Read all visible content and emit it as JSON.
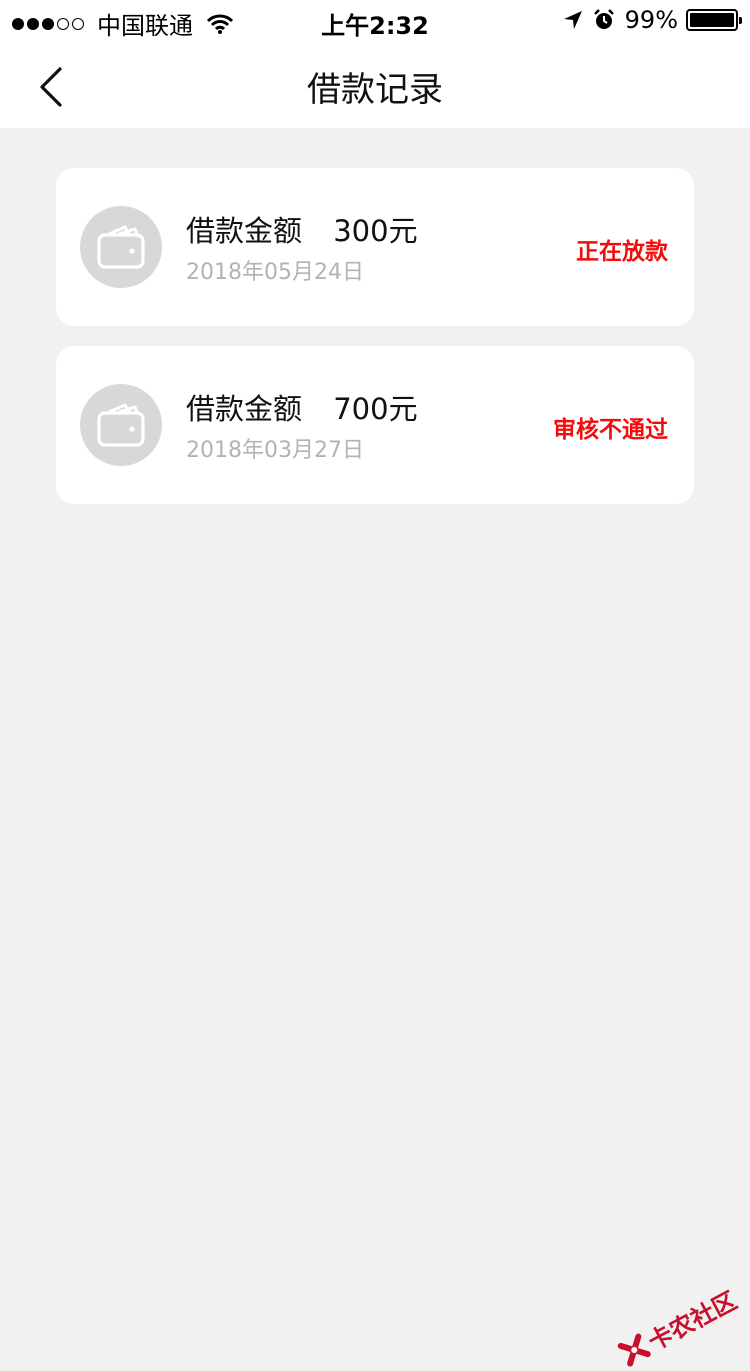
{
  "status_bar": {
    "carrier": "中国联通",
    "time": "上午2:32",
    "battery_text": "99%",
    "battery_level": 0.99,
    "signal": {
      "filled": 3,
      "total": 5
    },
    "icons": [
      "wifi-icon",
      "location-arrow-icon",
      "alarm-icon",
      "battery-icon"
    ]
  },
  "navbar": {
    "title": "借款记录",
    "back_icon": "chevron-left-icon"
  },
  "records": [
    {
      "label": "借款金额",
      "amount": "300元",
      "date": "2018年05月24日",
      "status": "正在放款",
      "icon": "wallet-icon"
    },
    {
      "label": "借款金额",
      "amount": "700元",
      "date": "2018年03月27日",
      "status": "审核不通过",
      "icon": "wallet-icon"
    }
  ],
  "watermark": {
    "text": "卡农社区",
    "icon": "logo-icon"
  },
  "colors": {
    "background": "#f1f1f1",
    "card": "#ffffff",
    "status_red": "#f40c0c",
    "date_gray": "#b3b3b3",
    "avatar_gray": "#d8d8d8"
  }
}
